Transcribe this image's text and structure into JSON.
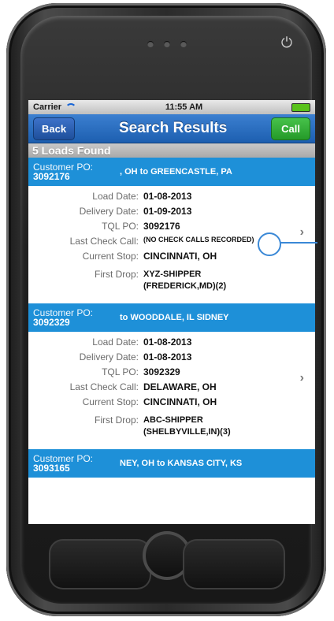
{
  "status": {
    "carrier": "Carrier",
    "time": "11:55 AM"
  },
  "nav": {
    "back": "Back",
    "title": "Search Results",
    "call": "Call"
  },
  "loads_found": "5 Loads Found",
  "labels": {
    "customer_po": "Customer PO:",
    "load_date": "Load Date:",
    "delivery_date": "Delivery Date:",
    "tql_po": "TQL PO:",
    "last_check_call": "Last Check Call:",
    "current_stop": "Current Stop:",
    "first_drop": "First Drop:"
  },
  "loads": [
    {
      "customer_po": "3092176",
      "route": ", OH to GREENCASTLE, PA",
      "load_date": "01-08-2013",
      "delivery_date": "01-09-2013",
      "tql_po": "3092176",
      "last_check_call": "(NO CHECK CALLS RECORDED)",
      "current_stop": "CINCINNATI, OH",
      "first_drop_line1": "XYZ-SHIPPER",
      "first_drop_line2": "(FREDERICK,MD)(2)"
    },
    {
      "customer_po": "3092329",
      "route": "to WOODDALE, IL    SIDNEY",
      "load_date": "01-08-2013",
      "delivery_date": "01-08-2013",
      "tql_po": "3092329",
      "last_check_call": "DELAWARE, OH",
      "current_stop": "CINCINNATI, OH",
      "first_drop_line1": "ABC-SHIPPER",
      "first_drop_line2": "(SHELBYVILLE,IN)(3)"
    },
    {
      "customer_po": "3093165",
      "route": "NEY, OH to KANSAS CITY, KS"
    }
  ],
  "icons": {
    "wifi": "wifi-icon",
    "battery": "battery-icon",
    "power": "power-icon",
    "chevron": "chevron-right-icon",
    "chevron_glyph": "›",
    "power_glyph": "⏻"
  }
}
